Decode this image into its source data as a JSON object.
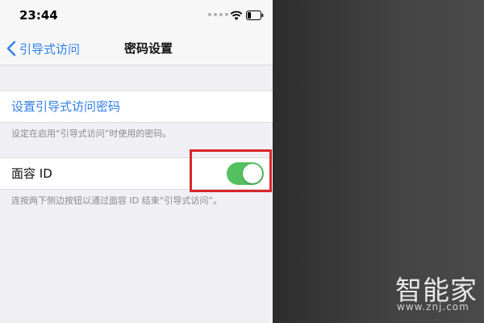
{
  "status_bar": {
    "time": "23:44",
    "wifi_icon": "wifi-icon",
    "battery_icon": "battery-low-icon"
  },
  "nav": {
    "back_label": "引导式访问",
    "title": "密码设置"
  },
  "settings": {
    "set_passcode_label": "设置引导式访问密码",
    "passcode_footer": "设定在启用“引导式访问”时使用的密码。",
    "face_id_label": "面容 ID",
    "face_id_enabled": true,
    "face_id_footer": "连按两下侧边按钮以通过面容 ID 结束“引导式访问”。"
  },
  "colors": {
    "accent": "#2f7fe8",
    "toggle_on": "#55c060",
    "highlight": "#d9262a"
  },
  "watermark": {
    "logo": "智能家",
    "url": "www.znj.com"
  }
}
